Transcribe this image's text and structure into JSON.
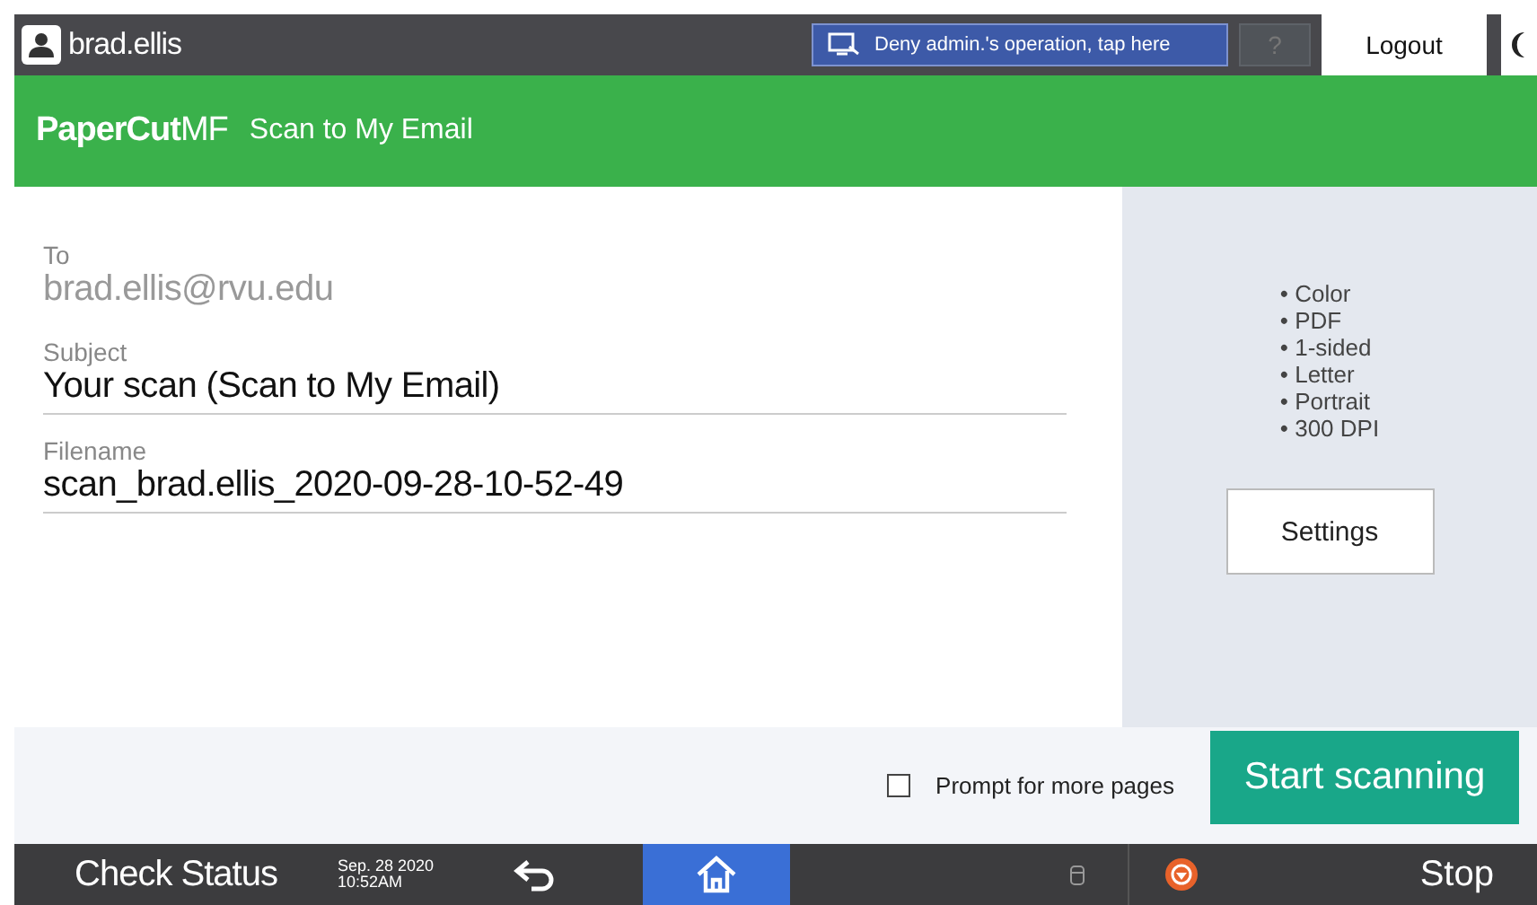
{
  "top_bar": {
    "user": "brad.ellis",
    "notice": "Deny admin.'s operation, tap here",
    "help": "?",
    "logout": "Logout"
  },
  "header": {
    "brand": "PaperCut",
    "brand_suffix": "MF",
    "title": "Scan to My Email"
  },
  "fields": [
    {
      "label": "To",
      "value": "brad.ellis@rvu.edu",
      "disabled": true
    },
    {
      "label": "Subject",
      "value": "Your scan (Scan to My Email)",
      "disabled": false
    },
    {
      "label": "Filename",
      "value": "scan_brad.ellis_2020-09-28-10-52-49",
      "disabled": false
    }
  ],
  "settings_summary": [
    "• Color",
    "• PDF",
    "• 1-sided",
    "• Letter",
    "• Portrait",
    "• 300 DPI"
  ],
  "settings_button": "Settings",
  "prompt_more_pages": {
    "label": "Prompt for more pages",
    "checked": false
  },
  "start_button": "Start scanning",
  "taskbar": {
    "check_status": "Check Status",
    "date": "Sep. 28 2020",
    "time": "10:52AM",
    "stop": "Stop"
  }
}
